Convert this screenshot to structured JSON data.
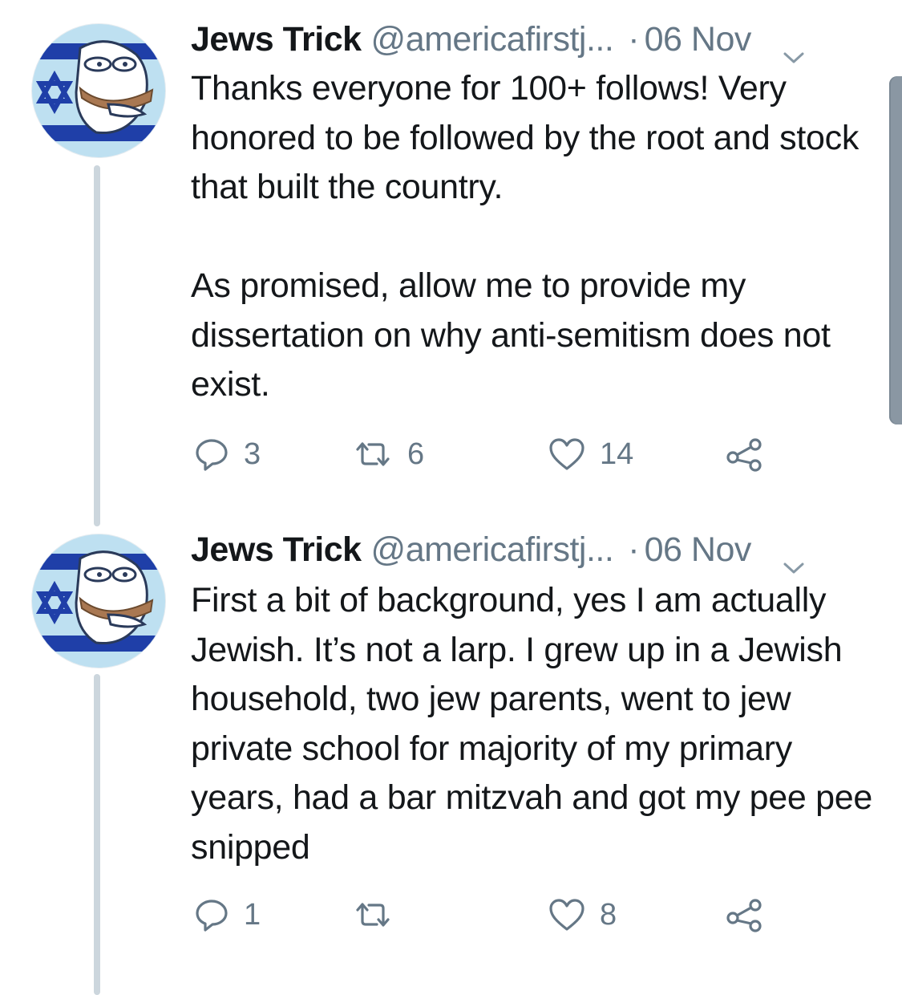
{
  "colors": {
    "primary_text": "#14171a",
    "secondary_text": "#657786",
    "thread_line": "#ccd6dd",
    "flag_blue": "#1f3fa8",
    "avatar_bg": "#9bd0ea"
  },
  "tweets": [
    {
      "author_name": "Jews Trick",
      "handle": "@americafirstj...",
      "separator": "·",
      "date": "06 Nov",
      "text": "Thanks everyone for 100+ follows! Very honored to be followed by the root and stock that built the country.\n\nAs promised, allow me to provide my dissertation on why anti-semitism does not exist.",
      "reply_count": "3",
      "retweet_count": "6",
      "like_count": "14",
      "icons": [
        "reply-icon",
        "retweet-icon",
        "like-icon",
        "share-icon",
        "chevron-down-icon"
      ]
    },
    {
      "author_name": "Jews Trick",
      "handle": "@americafirstj...",
      "separator": "·",
      "date": "06 Nov",
      "text": "First a bit of background, yes I am actually Jewish. It’s not a larp. I grew up in a Jewish household, two jew parents, went to jew private school for majority of my primary years, had a bar mitzvah and got my pee pee snipped",
      "reply_count": "1",
      "retweet_count": "",
      "like_count": "8",
      "icons": [
        "reply-icon",
        "retweet-icon",
        "like-icon",
        "share-icon",
        "chevron-down-icon"
      ]
    }
  ]
}
